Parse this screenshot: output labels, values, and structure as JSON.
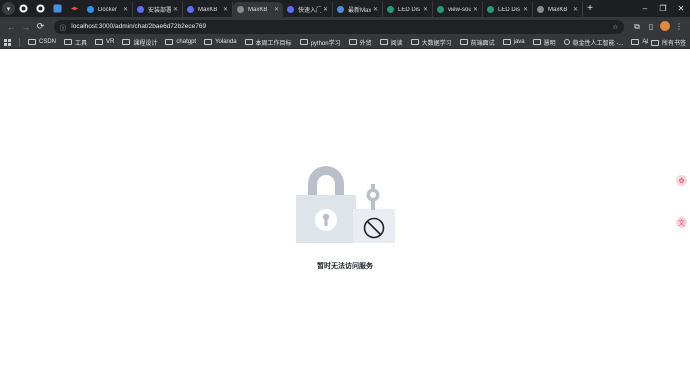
{
  "browser": {
    "tabs": [
      {
        "label": "Docker",
        "favicon_color": "#2496ed"
      },
      {
        "label": "安装部署",
        "favicon_color": "#5b6cff"
      },
      {
        "label": "MaxKB",
        "favicon_color": "#5b6cff"
      },
      {
        "label": "MaxKB",
        "favicon_color": "#8a8a8a",
        "active": true
      },
      {
        "label": "快速入门",
        "favicon_color": "#5b6cff"
      },
      {
        "label": "最新MaxKB",
        "favicon_color": "#4a90e2"
      },
      {
        "label": "LED Dis",
        "favicon_color": "#1e9e70"
      },
      {
        "label": "view-sou",
        "favicon_color": "#1e9e70"
      },
      {
        "label": "LED Dis",
        "favicon_color": "#1e9e70"
      },
      {
        "label": "MaxKB",
        "favicon_color": "#8a8a8a"
      }
    ],
    "address": {
      "url": "localhost:3000/admin/chat/2bae6d72b2ece769"
    },
    "bookmarks": [
      {
        "label": "CSDN",
        "type": "folder"
      },
      {
        "label": "工具",
        "type": "folder"
      },
      {
        "label": "VR",
        "type": "folder"
      },
      {
        "label": "课程设计",
        "type": "folder"
      },
      {
        "label": "chatgpt",
        "type": "folder"
      },
      {
        "label": "Yolanda",
        "type": "folder"
      },
      {
        "label": "本周工作目标",
        "type": "folder"
      },
      {
        "label": "python学习",
        "type": "folder"
      },
      {
        "label": "外贸",
        "type": "folder"
      },
      {
        "label": "阅读",
        "type": "folder"
      },
      {
        "label": "大数据学习",
        "type": "folder"
      },
      {
        "label": "前端面试",
        "type": "folder"
      },
      {
        "label": "java",
        "type": "folder"
      },
      {
        "label": "慧明",
        "type": "folder"
      },
      {
        "label": "稳金性人工智能 -...",
        "type": "link"
      },
      {
        "label": "AI",
        "type": "folder"
      }
    ],
    "all_bookmarks_label": "所有书签"
  },
  "page": {
    "message": "暂时无法访问服务",
    "illustration": "lock-forbidden-icon"
  },
  "colors": {
    "lock_body": "#dfe3ea",
    "lock_shackle": "#bac0ca",
    "lock_panel": "#e9ecf1",
    "keyhole": "#ffffff",
    "forbidden_stroke": "#1f2329"
  }
}
